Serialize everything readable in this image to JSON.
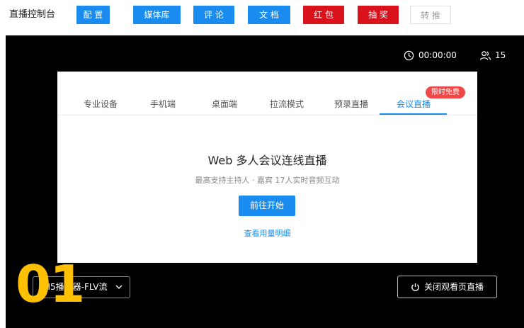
{
  "header": {
    "title": "直播控制台",
    "buttons": [
      {
        "label": "配 置",
        "style": "blue"
      },
      {
        "label": "媒体库",
        "style": "blue"
      },
      {
        "label": "评 论",
        "style": "blue"
      },
      {
        "label": "文 档",
        "style": "blue"
      },
      {
        "label": "红 包",
        "style": "red"
      },
      {
        "label": "抽 奖",
        "style": "red"
      },
      {
        "label": "转 推",
        "style": "ghost"
      }
    ]
  },
  "stage": {
    "timer": "00:00:00",
    "viewer_count": "15",
    "timer_icon": "clock-icon",
    "viewer_icon": "people-icon"
  },
  "panel": {
    "tabs": [
      "专业设备",
      "手机端",
      "桌面端",
      "拉流模式",
      "预录直播",
      "会议直播"
    ],
    "active_tab": "会议直播",
    "promo_badge": "限时免费",
    "headline": "Web 多人会议连线直播",
    "subline": "最高支持主持人 · 嘉宾 17人实时音频互动",
    "start_button": "前往开始",
    "usage_link": "查看用量明细"
  },
  "footer": {
    "player_select": "H5播放器-FLV流",
    "close_watch_button": "关闭观看页直播",
    "overlay_number": "01"
  },
  "colors": {
    "primary": "#1a8cf0",
    "danger": "#d9121c",
    "overlay": "#ffc000"
  }
}
